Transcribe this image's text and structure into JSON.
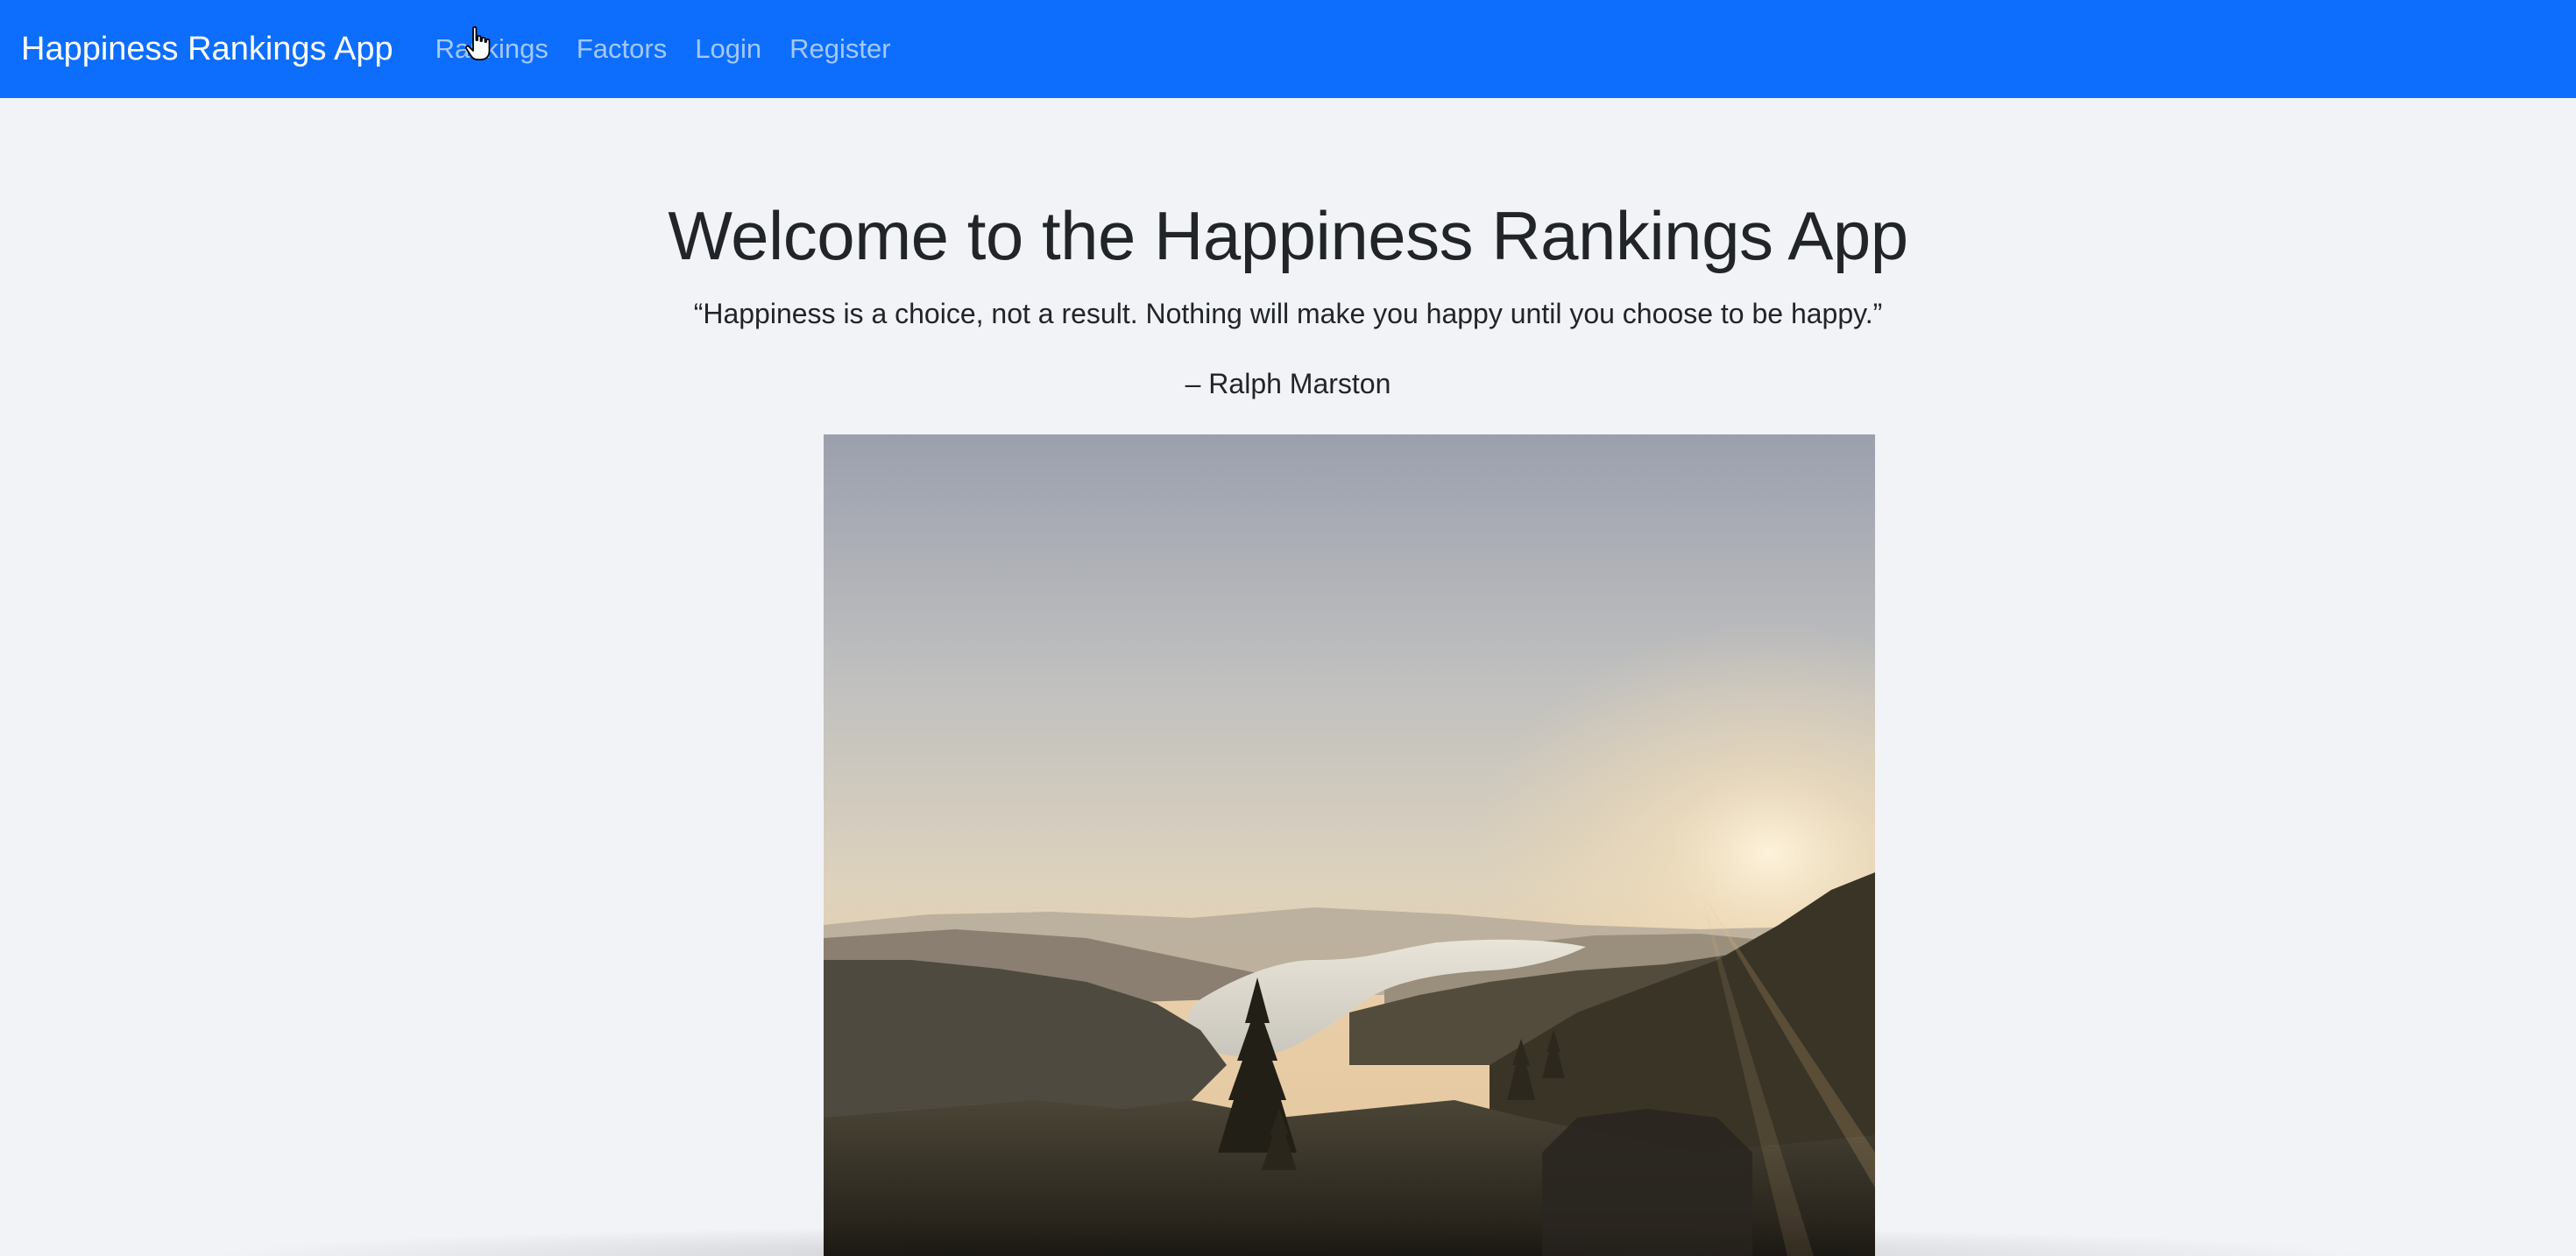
{
  "navbar": {
    "brand": "Happiness Rankings App",
    "links": [
      "Rankings",
      "Factors",
      "Login",
      "Register"
    ],
    "background": "#0d6efd"
  },
  "main": {
    "title": "Welcome to the Happiness Rankings App",
    "quote": "“Happiness is a choice, not a result. Nothing will make you happy until you choose to be happy.”",
    "author": "– Ralph Marston",
    "image": "landscape-sunset-river-valley"
  },
  "cursor": "hand-pointer-icon"
}
